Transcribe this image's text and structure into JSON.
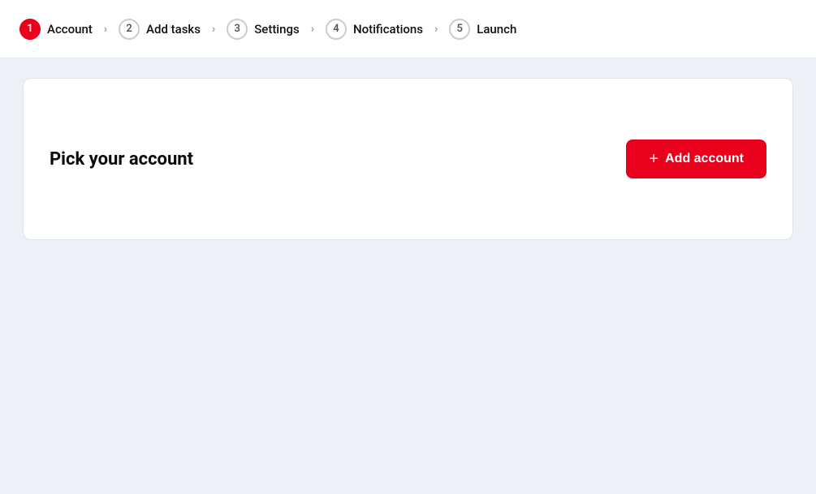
{
  "stepper": {
    "items": [
      {
        "number": "1",
        "label": "Account",
        "active": true
      },
      {
        "number": "2",
        "label": "Add tasks",
        "active": false
      },
      {
        "number": "3",
        "label": "Settings",
        "active": false
      },
      {
        "number": "4",
        "label": "Notifications",
        "active": false
      },
      {
        "number": "5",
        "label": "Launch",
        "active": false
      }
    ]
  },
  "card": {
    "title": "Pick your account",
    "add_button_label": "Add account",
    "add_button_plus": "+"
  },
  "colors": {
    "active_step": "#e8001c",
    "button_bg": "#e8001c"
  }
}
